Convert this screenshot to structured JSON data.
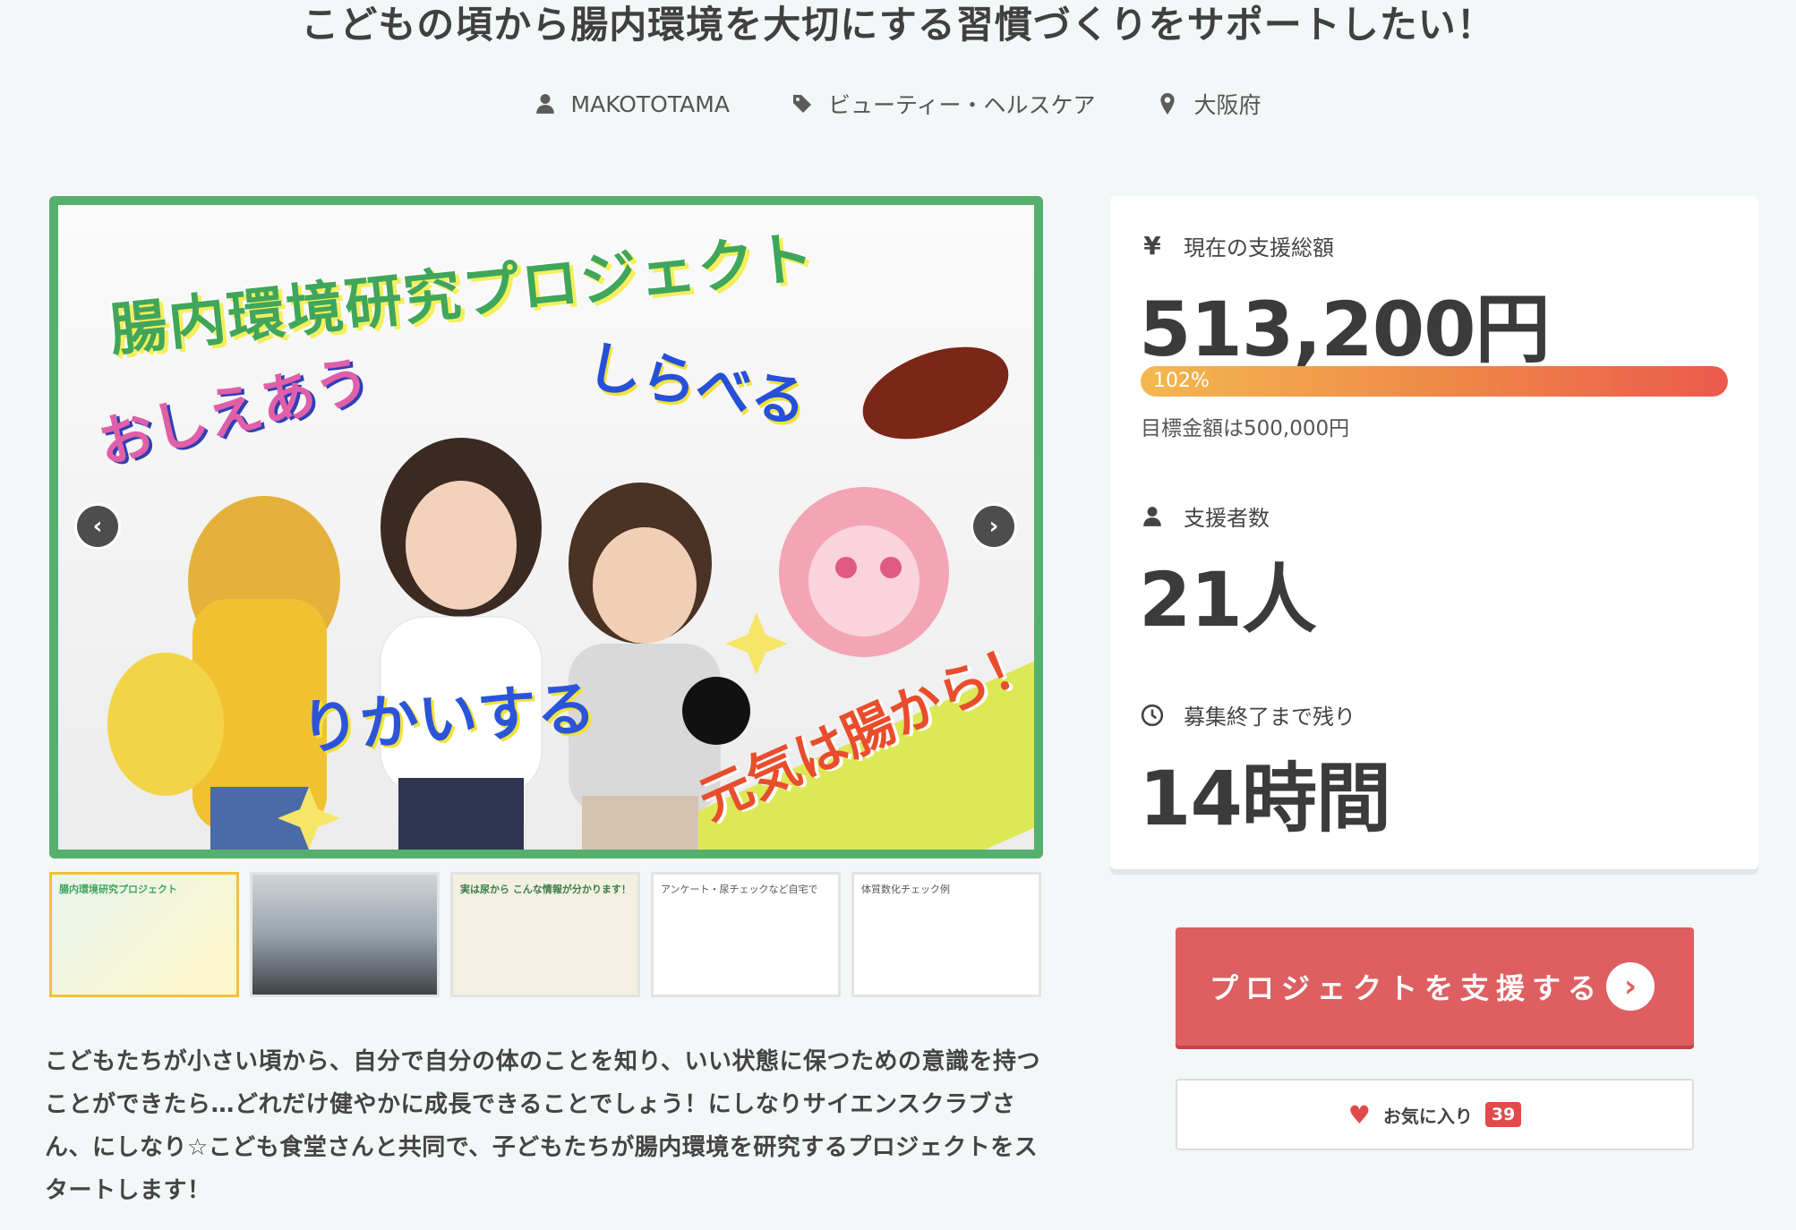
{
  "project": {
    "title": "こどもの頃から腸内環境を大切にする習慣づくりをサポートしたい！",
    "owner": "MAKOTOTAMA",
    "category": "ビューティー・ヘルスケア",
    "location": "大阪府"
  },
  "hero": {
    "title": "腸内環境研究プロジェクト",
    "word1": "おしえあう",
    "word2": "しらべる",
    "word3": "りかいする",
    "word4": "元気は腸から！",
    "prev_label": "‹",
    "next_label": "›"
  },
  "thumbnails": [
    {
      "label": "腸内環境研究プロジェクト"
    },
    {
      "label": ""
    },
    {
      "label": "実は尿から こんな情報が分かります！"
    },
    {
      "label": "アンケート・尿チェックなど自宅で"
    },
    {
      "label": "体質数化チェック例"
    }
  ],
  "description": "こどもたちが小さい頃から、自分で自分の体のことを知り、いい状態に保つための意識を持つことができたら…どれだけ健やかに成長できることでしょう！にしなりサイエンスクラブさん、にしなり☆こども食堂さんと共同で、子どもたちが腸内環境を研究するプロジェクトをスタートします！",
  "stats": {
    "amount_icon": "¥",
    "amount_label": "現在の支援総額",
    "amount_value": "513,200円",
    "progress_percent": 102,
    "progress_text": "102%",
    "goal_text": "目標金額は500,000円",
    "supporters_label": "支援者数",
    "supporters_value": "21人",
    "remaining_label": "募集終了まで残り",
    "remaining_value": "14時間"
  },
  "actions": {
    "support_label": "プロジェクトを支援する",
    "favorite_label": "お気に入り",
    "favorite_count": "39"
  },
  "colors": {
    "accent": "#dd5f61",
    "hero_border": "#55b06f",
    "progress_start": "#f4b84f",
    "progress_end": "#eb5a4c"
  }
}
